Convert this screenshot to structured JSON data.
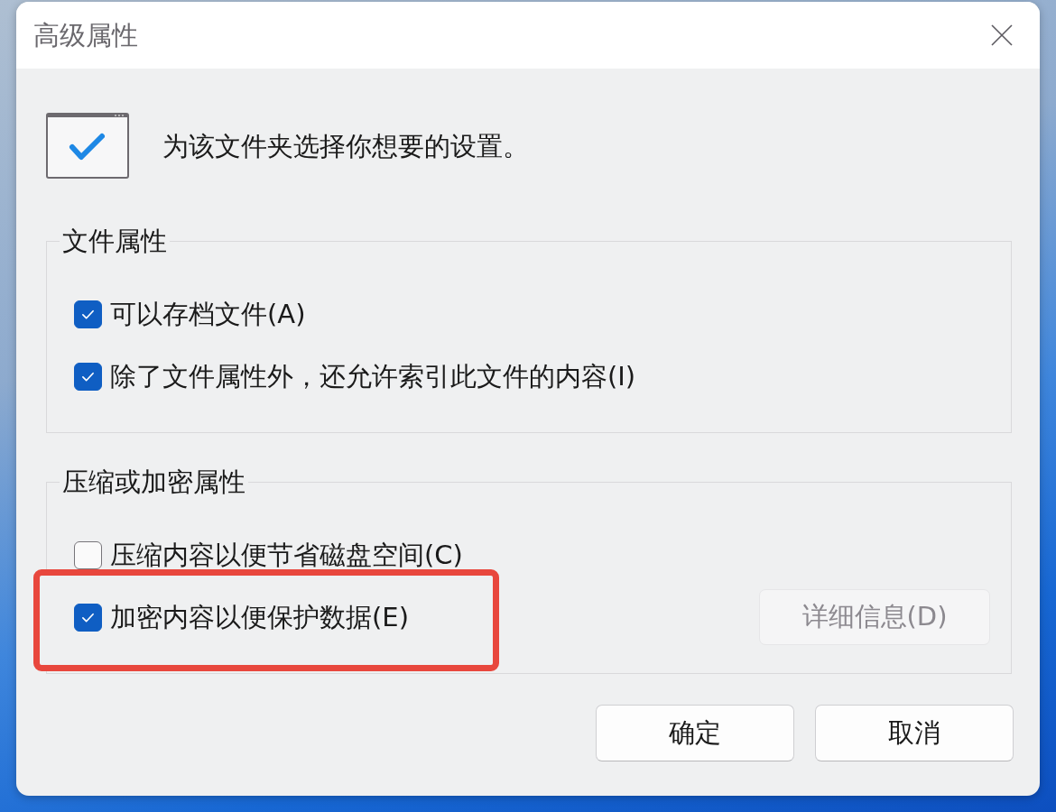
{
  "window": {
    "title": "高级属性"
  },
  "header": {
    "text": "为该文件夹选择你想要的设置。"
  },
  "groups": [
    {
      "title": "文件属性",
      "options": [
        {
          "label": "可以存档文件(A)",
          "checked": true,
          "highlighted": false
        },
        {
          "label": "除了文件属性外，还允许索引此文件的内容(I)",
          "checked": true,
          "highlighted": false
        }
      ]
    },
    {
      "title": "压缩或加密属性",
      "options": [
        {
          "label": "压缩内容以便节省磁盘空间(C)",
          "checked": false,
          "highlighted": false
        },
        {
          "label": "加密内容以便保护数据(E)",
          "checked": true,
          "highlighted": true,
          "button": {
            "label": "详细信息(D)",
            "disabled": true
          }
        }
      ]
    }
  ],
  "buttons": [
    {
      "label": "确定"
    },
    {
      "label": "取消"
    }
  ]
}
